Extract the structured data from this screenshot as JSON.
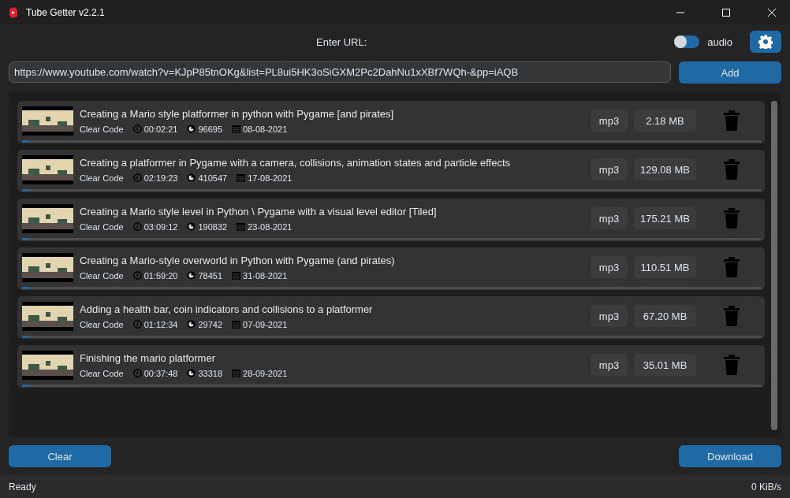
{
  "window": {
    "title": "Tube Getter v2.2.1"
  },
  "url_label": "Enter URL:",
  "audio_toggle": {
    "label": "audio",
    "on": false
  },
  "url_field": {
    "value": "https://www.youtube.com/watch?v=KJpP85tnOKg&list=PL8ui5HK3oSiGXM2Pc2DahNu1xXBf7WQh-&pp=iAQB"
  },
  "add_button": "Add",
  "videos": [
    {
      "title": "Creating a Mario style platformer in python with Pygame [and pirates]",
      "channel": "Clear Code",
      "duration": "00:02:21",
      "views": "96695",
      "date": "08-08-2021",
      "format": "mp3",
      "size": "2.18 MB",
      "level": 0.01
    },
    {
      "title": "Creating a platformer in Pygame with a camera, collisions, animation states and particle effects",
      "channel": "Clear Code",
      "duration": "02:19:23",
      "views": "410547",
      "date": "17-08-2021",
      "format": "mp3",
      "size": "129.08 MB",
      "level": 0.01
    },
    {
      "title": "Creating a Mario style level in Python \\ Pygame with a visual level editor [Tiled]",
      "channel": "Clear Code",
      "duration": "03:09:12",
      "views": "190832",
      "date": "23-08-2021",
      "format": "mp3",
      "size": "175.21 MB",
      "level": 0.01
    },
    {
      "title": "Creating a Mario-style overworld in Python with Pygame (and pirates)",
      "channel": "Clear Code",
      "duration": "01:59:20",
      "views": "78451",
      "date": "31-08-2021",
      "format": "mp3",
      "size": "110.51 MB",
      "level": 0.01
    },
    {
      "title": "Adding a health bar, coin indicators and collisions to a platformer",
      "channel": "Clear Code",
      "duration": "01:12:34",
      "views": "29742",
      "date": "07-09-2021",
      "format": "mp3",
      "size": "67.20 MB",
      "level": 0.01
    },
    {
      "title": "Finishing the mario platformer",
      "channel": "Clear Code",
      "duration": "00:37:48",
      "views": "33318",
      "date": "28-09-2021",
      "format": "mp3",
      "size": "35.01 MB",
      "level": 0.01
    }
  ],
  "clear_button": "Clear",
  "download_button": "Download",
  "status_bar": {
    "status": "Ready",
    "speed": "0 KiB/s"
  }
}
